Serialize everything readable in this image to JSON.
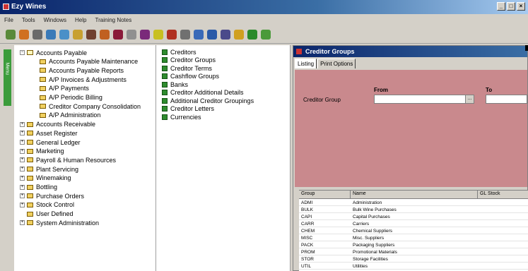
{
  "app": {
    "title": "Ezy Wines"
  },
  "menu": [
    "File",
    "Tools",
    "Windows",
    "Help",
    "Training Notes"
  ],
  "toolbar_icons": [
    "users-icon",
    "edit-icon",
    "printer-icon",
    "calculator-icon",
    "window-icon",
    "people-icon",
    "pen-icon",
    "box-icon",
    "wine-icon",
    "wand-icon",
    "grapes-icon",
    "wrench-icon",
    "bottle-icon",
    "gear-icon",
    "globe-icon",
    "help-icon",
    "monitor-icon",
    "package-icon",
    "leaf-icon",
    "vine-icon"
  ],
  "sidebar_tab": "Menu",
  "tree": [
    {
      "label": "Accounts Payable",
      "level": 0,
      "expanded": true
    },
    {
      "label": "Accounts Payable Maintenance",
      "level": 1
    },
    {
      "label": "Accounts Payable Reports",
      "level": 1
    },
    {
      "label": "A/P Invoices & Adjustments",
      "level": 1
    },
    {
      "label": "A/P Payments",
      "level": 1
    },
    {
      "label": "A/P Periodic Billing",
      "level": 1
    },
    {
      "label": "Creditor Company Consolidation",
      "level": 1
    },
    {
      "label": "A/P Administration",
      "level": 1
    },
    {
      "label": "Accounts Receivable",
      "level": 0
    },
    {
      "label": "Asset Register",
      "level": 0
    },
    {
      "label": "General Ledger",
      "level": 0
    },
    {
      "label": "Marketing",
      "level": 0
    },
    {
      "label": "Payroll & Human Resources",
      "level": 0
    },
    {
      "label": "Plant Servicing",
      "level": 0
    },
    {
      "label": "Winemaking",
      "level": 0
    },
    {
      "label": "Bottling",
      "level": 0
    },
    {
      "label": "Purchase Orders",
      "level": 0
    },
    {
      "label": "Stock Control",
      "level": 0
    },
    {
      "label": "User Defined",
      "level": 0,
      "leaf": true
    },
    {
      "label": "System Administration",
      "level": 0
    }
  ],
  "maintenance_items": [
    "Creditors",
    "Creditor Groups",
    "Creditor Terms",
    "Cashflow Groups",
    "Banks",
    "Creditor Additional Details",
    "Additional Creditor Groupings",
    "Creditor Letters",
    "Currencies"
  ],
  "creditor_groups": {
    "title": "Creditor Groups",
    "tabs": [
      "Listing",
      "Print Options"
    ],
    "field_label": "Creditor Group",
    "from_label": "From",
    "to_label": "To",
    "ellipsis": "...",
    "columns": [
      "Group",
      "Name",
      "GL Stock"
    ],
    "rows": [
      [
        "ADMI",
        "Administration"
      ],
      [
        "BULK",
        "Bulk Wine Purchases"
      ],
      [
        "CAPI",
        "Capital Purchases"
      ],
      [
        "CARR",
        "Carriers"
      ],
      [
        "CHEM",
        "Chemical Suppliers"
      ],
      [
        "MISC",
        "Misc. Suppliers"
      ],
      [
        "PACK",
        "Packaging Suppliers"
      ],
      [
        "PROM",
        "Promotional Materials"
      ],
      [
        "STOR",
        "Storage Facilities"
      ],
      [
        "UTIL",
        "Utilities"
      ]
    ]
  }
}
